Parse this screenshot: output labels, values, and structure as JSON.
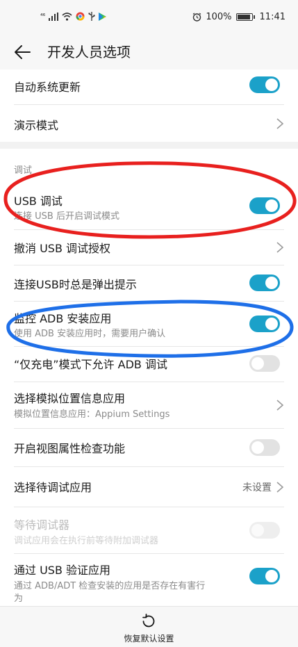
{
  "status_bar": {
    "network": "⁴⁶",
    "battery_text": "100%",
    "time": "11:41"
  },
  "app_bar": {
    "title": "开发人员选项"
  },
  "settings": {
    "auto_update": {
      "label": "自动系统更新",
      "enabled": true
    },
    "demo_mode": {
      "label": "演示模式"
    },
    "debug_section": {
      "header": "调试"
    },
    "usb_debugging": {
      "label": "USB 调试",
      "summary": "连接 USB 后开启调试模式",
      "enabled": true
    },
    "revoke_usb": {
      "label": "撤消 USB 调试授权"
    },
    "usb_prompt": {
      "label": "连接USB时总是弹出提示",
      "enabled": true
    },
    "monitor_adb": {
      "label": "监控 ADB 安装应用",
      "summary": "使用 ADB 安装应用时，需要用户确认",
      "enabled": true
    },
    "charge_only_adb": {
      "label": "“仅充电”模式下允许 ADB 调试",
      "enabled": false
    },
    "mock_location": {
      "label": "选择模拟位置信息应用",
      "summary": "模拟位置信息应用：Appium Settings"
    },
    "view_attr": {
      "label": "开启视图属性检查功能",
      "enabled": false
    },
    "debug_app": {
      "label": "选择待调试应用",
      "value": "未设置"
    },
    "wait_debugger": {
      "label": "等待调试器",
      "summary": "调试应用会在执行前等待附加调试器",
      "enabled": false
    },
    "verify_usb": {
      "label": "通过 USB 验证应用",
      "summary": "通过 ADB/ADT 检查安装的应用是否存在有害行",
      "summary_cont": "为",
      "enabled": true
    }
  },
  "bottom": {
    "reset_label": "恢复默认设置"
  },
  "colors": {
    "accent": "#1ba1c9",
    "red_annotation": "#e8201e",
    "blue_annotation": "#1e6fe8"
  }
}
